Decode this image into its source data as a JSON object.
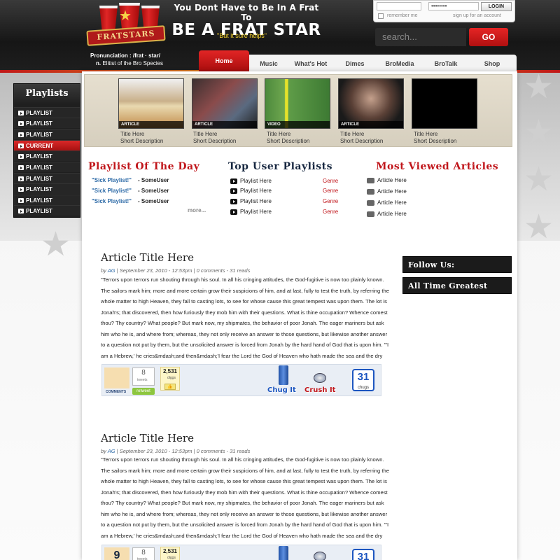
{
  "header": {
    "logo_text": "FRATSTARS",
    "pronunciation_label": "Pronunciation :",
    "pronunciation": "/frat · star/",
    "definition_label": "n.",
    "definition": "Elitist of the Bro Species",
    "headline_top": "You Dont Have to Be In A Frat To",
    "headline_main": "BE A FRAT STAR",
    "tagline": "\"But it sure helps\""
  },
  "login": {
    "password_value": "••••••••",
    "button": "LOGIN",
    "remember": "remember me",
    "signup": "sign up for an account"
  },
  "search": {
    "placeholder": "search...",
    "button": "GO"
  },
  "nav": [
    "Home",
    "Music",
    "What's Hot",
    "Dimes",
    "BroMedia",
    "BroTalk",
    "Shop"
  ],
  "slider": [
    {
      "tag": "ARTICLE",
      "title": "Title Here",
      "desc": "Short Description"
    },
    {
      "tag": "ARTICLE",
      "title": "Title Here",
      "desc": "Short Description"
    },
    {
      "tag": "VIDEO",
      "title": "Title Here",
      "desc": "Short Description"
    },
    {
      "tag": "ARTICLE",
      "title": "Title Here",
      "desc": "Short Description"
    },
    {
      "tag": "",
      "title": "Title Here",
      "desc": "Short Description"
    }
  ],
  "sidebar": {
    "title": "Playlists",
    "items": [
      "PLAYLIST",
      "PLAYLIST",
      "PLAYLIST",
      "CURRENT",
      "PLAYLIST",
      "PLAYLIST",
      "PLAYLIST",
      "PLAYLIST",
      "PLAYLIST",
      "PLAYLIST"
    ]
  },
  "potd": {
    "title": "Playlist Of The Day",
    "items": [
      {
        "name": "\"Sick Playlist!\"",
        "user": "- SomeUser"
      },
      {
        "name": "\"Sick Playlist!\"",
        "user": "- SomeUser"
      },
      {
        "name": "\"Sick Playlist!\"",
        "user": "- SomeUser"
      }
    ],
    "more": "more..."
  },
  "top_user": {
    "title": "Top User Playlists",
    "items": [
      {
        "name": "Playlist Here",
        "genre": "Genre"
      },
      {
        "name": "Playlist Here",
        "genre": "Genre"
      },
      {
        "name": "Playlist Here",
        "genre": "Genre"
      },
      {
        "name": "Playlist Here",
        "genre": "Genre"
      }
    ]
  },
  "most_viewed": {
    "title": "Most Viewed Articles",
    "items": [
      "Article Here",
      "Article Here",
      "Article Here",
      "Article Here"
    ]
  },
  "articles": [
    {
      "title": "Article Title Here",
      "meta_by": "by ",
      "author": "AG",
      "meta_rest": " | September 23, 2010 - 12:53pm | 0 comments - 31 reads",
      "body": "\"Terrors upon terrors run shouting through his soul. In all his cringing attitudes, the God-fugitive is now too plainly known. The sailors mark him; more and more certain grow their suspicions of him, and at last, fully to test the truth, by referring the whole matter to high Heaven, they fall to casting lots, to see for whose cause this great tempest was upon them. The lot is Jonah's; that discovered, then how furiously they mob him with their questions. What is thine occupation? Whence comest thou? Thy country? What people? But mark now, my shipmates, the behavior of poor Jonah. The eager mariners but ask him who he is, and where from; whereas, they not only receive an answer to those questions, but likewise another answer to a question not put by them, but the unsolicited answer is forced from Jonah by the hard hand of God that is upon him. \"'I am a Hebrew,' he cries&mdash;and then&mdash;'I fear the Lord the God of Heaven who hath made the sea and the dry land!' Fear him, O Jonah? Aye, well mightest thou fear",
      "comments_label": "COMMENTS",
      "tweets": "8",
      "tweets_label": "tweets",
      "retweet": "retweet",
      "diggs": "2,531",
      "diggs_label": "diggs",
      "chug": "Chug It",
      "crush": "Crush It",
      "chugs": "31",
      "chugs_label": "chugs"
    },
    {
      "title": "Article Title Here",
      "meta_by": "by ",
      "author": "AG",
      "meta_rest": " | September 23, 2010 - 12:53pm | 0 comments - 31 reads",
      "body": "\"Terrors upon terrors run shouting through his soul. In all his cringing attitudes, the God-fugitive is now too plainly known. The sailors mark him; more and more certain grow their suspicions of him, and at last, fully to test the truth, by referring the whole matter to high Heaven, they fall to casting lots, to see for whose cause this great tempest was upon them. The lot is Jonah's; that discovered, then how furiously they mob him with their questions. What is thine occupation? Whence comest thou? Thy country? What people? But mark now, my shipmates, the behavior of poor Jonah. The eager mariners but ask him who he is, and where from; whereas, they not only receive an answer to those questions, but likewise another answer to a question not put by them, but the unsolicited answer is forced from Jonah by the hard hand of God that is upon him. \"'I am a Hebrew,' he cries&mdash;and then&mdash;'I fear the Lord the God of Heaven who hath made the sea and the dry land!' Fear him, O Jonah? Aye, well mightest thou fear",
      "comments_count": "9",
      "tweets": "8",
      "tweets_label": "tweets",
      "diggs": "2,531",
      "diggs_label": "diggs",
      "chugs": "31"
    }
  ],
  "right_column": [
    "Follow Us:",
    "All Time Greatest"
  ],
  "colors": {
    "accent_red": "#c0151a",
    "navy": "#16263f",
    "link_blue": "#2d6aa7"
  }
}
